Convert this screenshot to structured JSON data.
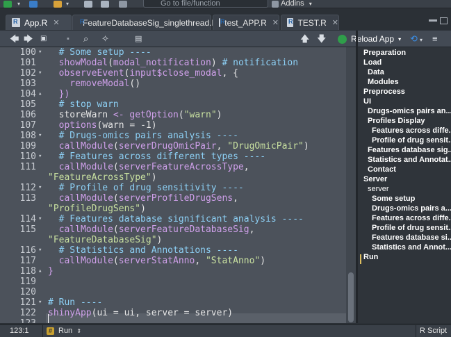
{
  "toolbar": {
    "goto_placeholder": "Go to file/function",
    "addins_label": "Addins"
  },
  "tabs": [
    {
      "label": "App.R",
      "active": true
    },
    {
      "label": "FeatureDatabaseSig_singlethread.R",
      "active": false
    },
    {
      "label": "test_APP.R",
      "active": false
    },
    {
      "label": "TEST.R",
      "active": false
    }
  ],
  "editor_toolbar": {
    "reload_label": "Reload App"
  },
  "code_lines": [
    {
      "num": "100",
      "fold": "▾",
      "segs": [
        {
          "t": "  # Some setup ----",
          "c": "cm"
        }
      ]
    },
    {
      "num": "101",
      "fold": "",
      "segs": [
        {
          "t": "  showModal",
          "c": "fn"
        },
        {
          "t": "(",
          "c": "op"
        },
        {
          "t": "modal_notification",
          "c": "fn"
        },
        {
          "t": ") ",
          "c": "op"
        },
        {
          "t": "# notification",
          "c": "cm"
        }
      ]
    },
    {
      "num": "102",
      "fold": "▾",
      "segs": [
        {
          "t": "  observeEvent",
          "c": "fn"
        },
        {
          "t": "(",
          "c": "op"
        },
        {
          "t": "input$close_modal",
          "c": "fn"
        },
        {
          "t": ", {",
          "c": "op"
        }
      ]
    },
    {
      "num": "103",
      "fold": "",
      "segs": [
        {
          "t": "    removeModal",
          "c": "fn"
        },
        {
          "t": "()",
          "c": "op"
        }
      ]
    },
    {
      "num": "104",
      "fold": "▴",
      "segs": [
        {
          "t": "  })",
          "c": "fn"
        }
      ]
    },
    {
      "num": "105",
      "fold": "",
      "segs": [
        {
          "t": "  # stop warn",
          "c": "cm"
        }
      ]
    },
    {
      "num": "106",
      "fold": "",
      "segs": [
        {
          "t": "  storeWarn ",
          "c": "op"
        },
        {
          "t": "<- ",
          "c": "fn"
        },
        {
          "t": "getOption",
          "c": "fn"
        },
        {
          "t": "(",
          "c": "op"
        },
        {
          "t": "\"warn\"",
          "c": "st"
        },
        {
          "t": ")",
          "c": "op"
        }
      ]
    },
    {
      "num": "107",
      "fold": "",
      "segs": [
        {
          "t": "  options",
          "c": "fn"
        },
        {
          "t": "(warn = -1)",
          "c": "op"
        }
      ]
    },
    {
      "num": "108",
      "fold": "▾",
      "segs": [
        {
          "t": "  # Drugs-omics pairs analysis ----",
          "c": "cm"
        }
      ]
    },
    {
      "num": "109",
      "fold": "",
      "segs": [
        {
          "t": "  callModule",
          "c": "fn"
        },
        {
          "t": "(",
          "c": "op"
        },
        {
          "t": "serverDrugOmicPair",
          "c": "fn"
        },
        {
          "t": ", ",
          "c": "op"
        },
        {
          "t": "\"DrugOmicPair\"",
          "c": "st"
        },
        {
          "t": ")",
          "c": "op"
        }
      ]
    },
    {
      "num": "110",
      "fold": "▾",
      "segs": [
        {
          "t": "  # Features across different types ----",
          "c": "cm"
        }
      ]
    },
    {
      "num": "111",
      "fold": "",
      "segs": [
        {
          "t": "  callModule",
          "c": "fn"
        },
        {
          "t": "(",
          "c": "op"
        },
        {
          "t": "serverFeatureAcrossType",
          "c": "fn"
        },
        {
          "t": ",",
          "c": "op"
        }
      ]
    },
    {
      "num": "",
      "fold": "",
      "segs": [
        {
          "t": "\"FeatureAcrossType\"",
          "c": "st"
        },
        {
          "t": ")",
          "c": "op"
        }
      ],
      "cont": true
    },
    {
      "num": "112",
      "fold": "▾",
      "segs": [
        {
          "t": "  # Profile of drug sensitivity ----",
          "c": "cm"
        }
      ]
    },
    {
      "num": "113",
      "fold": "",
      "segs": [
        {
          "t": "  callModule",
          "c": "fn"
        },
        {
          "t": "(",
          "c": "op"
        },
        {
          "t": "serverProfileDrugSens",
          "c": "fn"
        },
        {
          "t": ",",
          "c": "op"
        }
      ]
    },
    {
      "num": "",
      "fold": "",
      "segs": [
        {
          "t": "\"ProfileDrugSens\"",
          "c": "st"
        },
        {
          "t": ")",
          "c": "op"
        }
      ],
      "cont": true
    },
    {
      "num": "114",
      "fold": "▾",
      "segs": [
        {
          "t": "  # Features database significant analysis ----",
          "c": "cm"
        }
      ]
    },
    {
      "num": "115",
      "fold": "",
      "segs": [
        {
          "t": "  callModule",
          "c": "fn"
        },
        {
          "t": "(",
          "c": "op"
        },
        {
          "t": "serverFeatureDatabaseSig",
          "c": "fn"
        },
        {
          "t": ",",
          "c": "op"
        }
      ]
    },
    {
      "num": "",
      "fold": "",
      "segs": [
        {
          "t": "\"FeatureDatabaseSig\"",
          "c": "st"
        },
        {
          "t": ")",
          "c": "op"
        }
      ],
      "cont": true
    },
    {
      "num": "116",
      "fold": "▾",
      "segs": [
        {
          "t": "  # Statistics and Annotations ----",
          "c": "cm"
        }
      ]
    },
    {
      "num": "117",
      "fold": "",
      "segs": [
        {
          "t": "  callModule",
          "c": "fn"
        },
        {
          "t": "(",
          "c": "op"
        },
        {
          "t": "serverStatAnno",
          "c": "fn"
        },
        {
          "t": ", ",
          "c": "op"
        },
        {
          "t": "\"StatAnno\"",
          "c": "st"
        },
        {
          "t": ")",
          "c": "op"
        }
      ]
    },
    {
      "num": "118",
      "fold": "▴",
      "segs": [
        {
          "t": "}",
          "c": "fn"
        }
      ]
    },
    {
      "num": "119",
      "fold": "",
      "segs": []
    },
    {
      "num": "120",
      "fold": "",
      "segs": []
    },
    {
      "num": "121",
      "fold": "▾",
      "segs": [
        {
          "t": "# Run ----",
          "c": "cm"
        }
      ]
    },
    {
      "num": "122",
      "fold": "",
      "segs": [
        {
          "t": "shinyApp",
          "c": "fn"
        },
        {
          "t": "(ui = ui, server = server)",
          "c": "op"
        }
      ]
    },
    {
      "num": "123",
      "fold": "",
      "segs": []
    }
  ],
  "outline": [
    {
      "label": "Preparation",
      "indent": 0,
      "bold": true
    },
    {
      "label": "Load",
      "indent": 0,
      "bold": true
    },
    {
      "label": "Data",
      "indent": 1,
      "bold": true
    },
    {
      "label": "Modules",
      "indent": 1,
      "bold": true
    },
    {
      "label": "Preprocess",
      "indent": 0,
      "bold": true
    },
    {
      "label": "UI",
      "indent": 0,
      "bold": true
    },
    {
      "label": "Drugs-omics pairs an...",
      "indent": 1,
      "bold": true
    },
    {
      "label": "Profiles Display",
      "indent": 1,
      "bold": true
    },
    {
      "label": "Features across diffe...",
      "indent": 2,
      "bold": true
    },
    {
      "label": "Profile of drug sensit...",
      "indent": 2,
      "bold": true
    },
    {
      "label": "Features database sig...",
      "indent": 1,
      "bold": true
    },
    {
      "label": "Statistics and Annotat...",
      "indent": 1,
      "bold": true
    },
    {
      "label": "Contact",
      "indent": 1,
      "bold": true
    },
    {
      "label": "Server",
      "indent": 0,
      "bold": true
    },
    {
      "label": "server",
      "indent": 1,
      "bold": false
    },
    {
      "label": "Some setup",
      "indent": 2,
      "bold": true
    },
    {
      "label": "Drugs-omics pairs a...",
      "indent": 2,
      "bold": true
    },
    {
      "label": "Features across diffe...",
      "indent": 2,
      "bold": true
    },
    {
      "label": "Profile of drug sensit...",
      "indent": 2,
      "bold": true
    },
    {
      "label": "Features database si...",
      "indent": 2,
      "bold": true
    },
    {
      "label": "Statistics and Annot...",
      "indent": 2,
      "bold": true
    },
    {
      "label": "Run",
      "indent": 0,
      "bold": true
    }
  ],
  "status": {
    "position": "123:1",
    "scope": "Run",
    "file_type": "R Script"
  }
}
